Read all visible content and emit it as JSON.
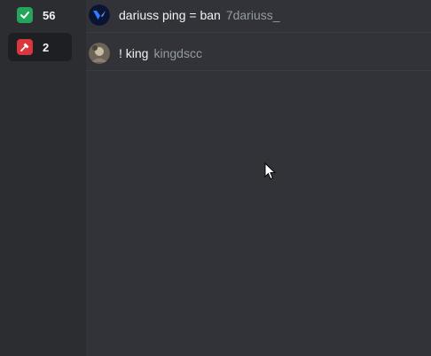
{
  "stats": [
    {
      "icon": "check-icon",
      "count": "56",
      "color": "#23a55a"
    },
    {
      "icon": "ban-hammer-icon",
      "count": "2",
      "color": "#da373c"
    }
  ],
  "members": [
    {
      "display_name": "dariuss ping = ban",
      "username": "7dariuss_",
      "avatar": "blue-valorant-avatar"
    },
    {
      "display_name": "! king",
      "username": "kingdscc",
      "avatar": "photo-avatar"
    }
  ],
  "colors": {
    "background": "#313338",
    "sidebar": "#2b2d31",
    "text_primary": "#f2f3f5",
    "text_secondary": "#949ba4"
  }
}
